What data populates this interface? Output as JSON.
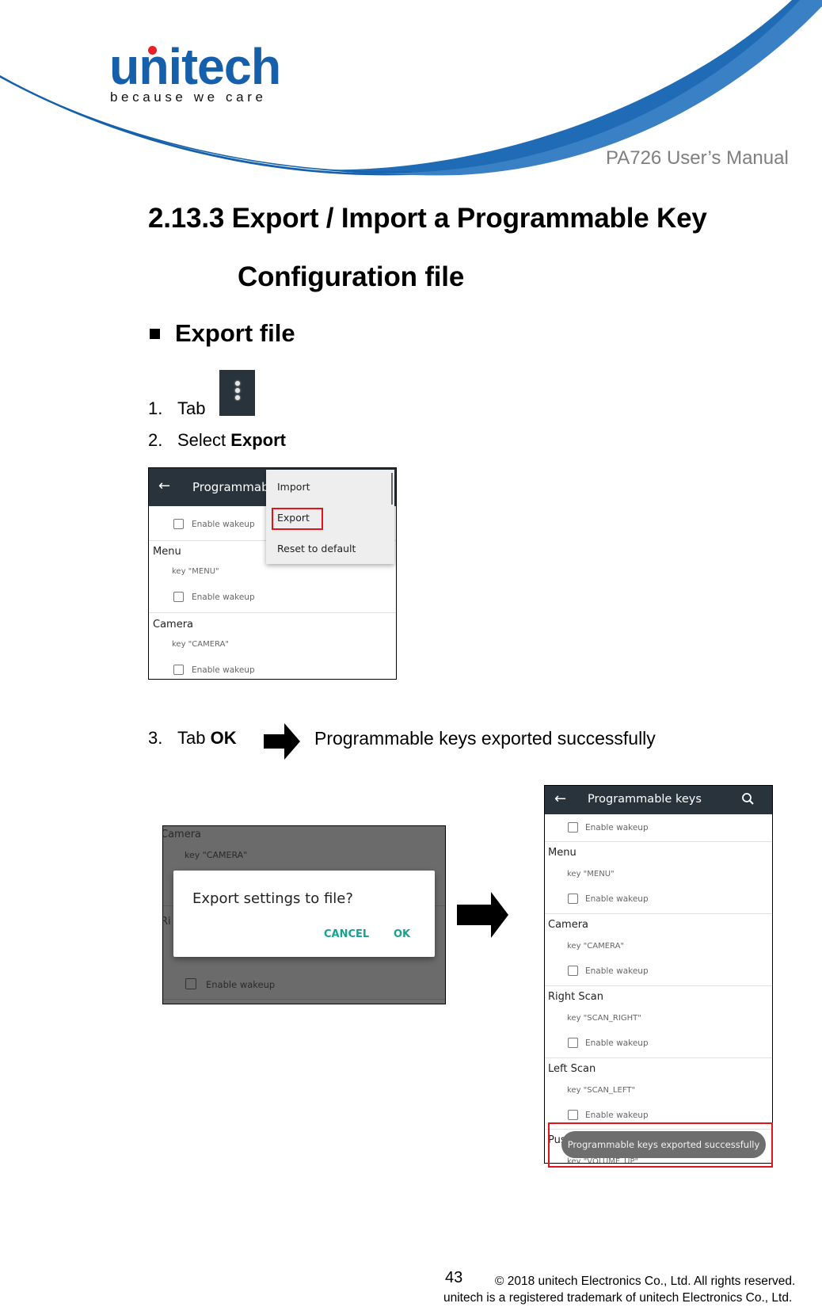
{
  "header": {
    "logo_text": "unitech",
    "tagline": "because we care",
    "manual_title": "PA726 User’s Manual",
    "brand_color": "#1660ab",
    "dot_color": "#e8202a"
  },
  "section": {
    "title_line1": "2.13.3 Export / Import a Programmable Key",
    "title_line2": "Configuration file",
    "subsection": "Export file"
  },
  "steps": [
    {
      "num": "1.",
      "text": "Tab",
      "icon": "overflow-menu-icon"
    },
    {
      "num": "2.",
      "text": "Select",
      "bold": "Export"
    },
    {
      "num": "3.",
      "text": "Tab",
      "bold": "OK",
      "arrow_icon": "right-arrow-icon",
      "result": "Programmable keys exported successfully"
    }
  ],
  "screen1": {
    "appbar_title": "Programmab",
    "rows": [
      {
        "checkbox_label": "Enable wakeup"
      },
      {
        "title": "Menu",
        "key": "key \"MENU\"",
        "checkbox_label": "Enable wakeup"
      },
      {
        "title": "Camera",
        "key": "key \"CAMERA\"",
        "checkbox_label": "Enable wakeup"
      }
    ],
    "menu_items": [
      "Import",
      "Export",
      "Reset to default"
    ],
    "highlighted_item": "Export"
  },
  "screen2": {
    "bg_rows": [
      {
        "title": "Camera",
        "key": "key \"CAMERA\""
      },
      {
        "title": "Ri"
      },
      {
        "checkbox_label": "Enable wakeup"
      }
    ],
    "dialog": {
      "title": "Export settings to file?",
      "cancel": "CANCEL",
      "ok": "OK",
      "accent": "#1aa18e"
    }
  },
  "screen3": {
    "appbar_title": "Programmable keys",
    "rows": [
      {
        "checkbox_label": "Enable wakeup"
      },
      {
        "title": "Menu",
        "key": "key \"MENU\"",
        "checkbox_label": "Enable wakeup"
      },
      {
        "title": "Camera",
        "key": "key \"CAMERA\"",
        "checkbox_label": "Enable wakeup"
      },
      {
        "title": "Right Scan",
        "key": "key \"SCAN_RIGHT\"",
        "checkbox_label": "Enable wakeup"
      },
      {
        "title": "Left Scan",
        "key": "key \"SCAN_LEFT\"",
        "checkbox_label": "Enable wakeup"
      },
      {
        "title": "Push to Talk",
        "key": "key \"VOLUME_UP\""
      }
    ],
    "toast": "Programmable keys exported successfully"
  },
  "footer": {
    "page_number": "43",
    "copyright": "© 2018 unitech Electronics Co., Ltd. All rights reserved.",
    "trademark": "unitech is a registered trademark of unitech Electronics Co., Ltd."
  }
}
